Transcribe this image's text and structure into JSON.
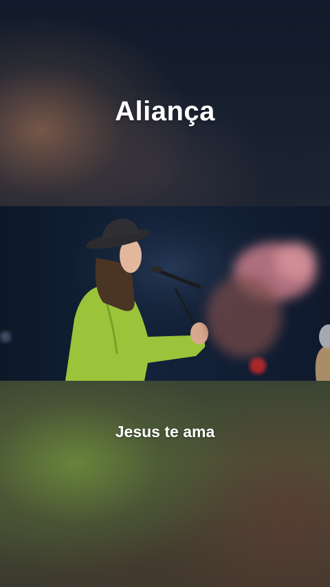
{
  "overlay": {
    "title": "Aliança",
    "subtitle": "Jesus te ama"
  },
  "colors": {
    "text": "#ffffff",
    "background_dark": "#0f1826",
    "jacket_green": "#9cc43a"
  }
}
